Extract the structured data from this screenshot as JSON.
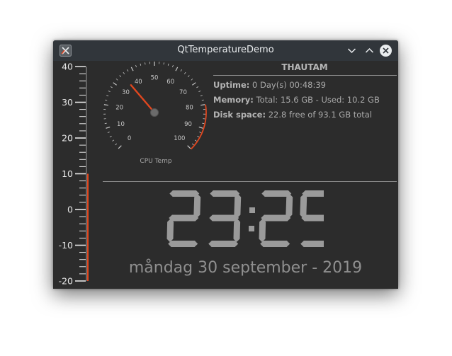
{
  "window": {
    "title": "QtTemperatureDemo",
    "app_icon": "qt-x-icon",
    "controls": [
      "minimize-icon",
      "maximize-icon",
      "close-icon"
    ]
  },
  "thermometer": {
    "scale_labels": [
      "40",
      "30",
      "20",
      "10",
      "0",
      "-10",
      "-20"
    ],
    "min": -20,
    "max": 40,
    "level": 10,
    "bar_color": "#e0471f"
  },
  "gauge": {
    "label": "CPU Temp",
    "scale_labels": [
      "0",
      "10",
      "20",
      "30",
      "40",
      "50",
      "60",
      "70",
      "80",
      "90",
      "100"
    ],
    "min": 0,
    "max": 100,
    "value": 35,
    "needle_color": "#e0471f",
    "red_zone_start": 80
  },
  "system": {
    "hostname": "THAUTAM",
    "uptime_label": "Uptime:",
    "uptime_value": "0 Day(s) 00:48:39",
    "memory_label": "Memory:",
    "memory_value": "Total: 15.6 GB - Used: 10.2 GB",
    "disk_label": "Disk space:",
    "disk_value": "22.8 free of 93.1 GB total"
  },
  "clock": {
    "time": "23:25",
    "date": "måndag 30 september - 2019"
  }
}
